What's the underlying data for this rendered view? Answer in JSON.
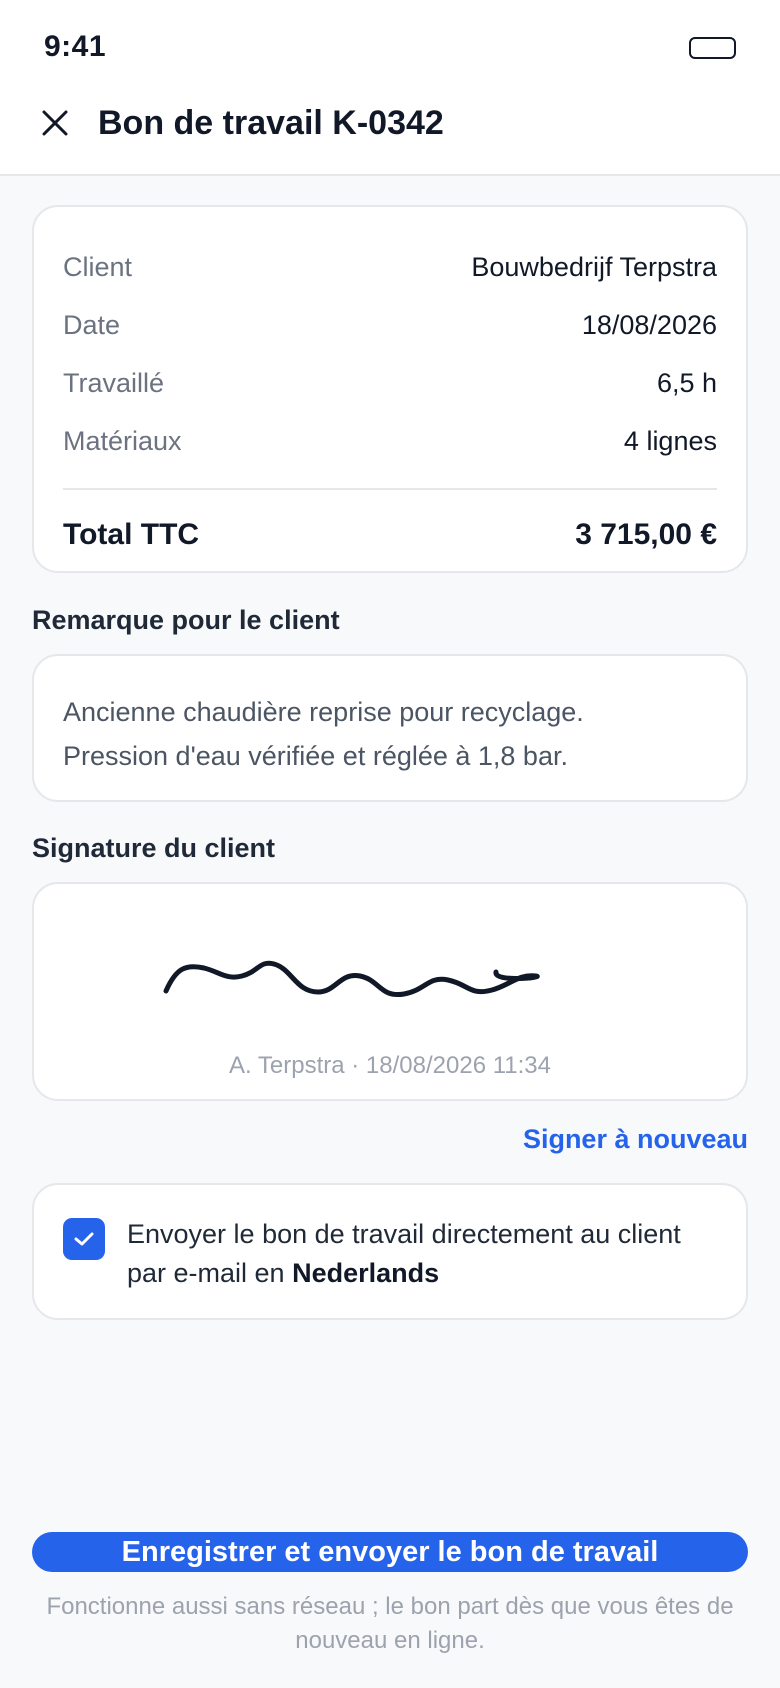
{
  "status_bar": {
    "time": "9:41"
  },
  "header": {
    "title": "Bon de travail K-0342"
  },
  "summary": {
    "rows": [
      {
        "label": "Client",
        "value": "Bouwbedrijf Terpstra"
      },
      {
        "label": "Date",
        "value": "18/08/2026"
      },
      {
        "label": "Travaillé",
        "value": "6,5 h"
      },
      {
        "label": "Matériaux",
        "value": "4 lignes"
      }
    ],
    "total_label": "Total TTC",
    "total_value": "3 715,00 €"
  },
  "remark": {
    "label": "Remarque pour le client",
    "lines": [
      "Ancienne chaudière reprise pour recyclage.",
      "Pression d'eau vérifiée et réglée à 1,8 bar."
    ]
  },
  "signature": {
    "label": "Signature du client",
    "caption": "A. Terpstra · 18/08/2026 11:34",
    "resign_label": "Signer à nouveau"
  },
  "email_option": {
    "checked": true,
    "text": "Envoyer le bon de travail directement au client par e-mail en",
    "language": "Nederlands"
  },
  "primary_action": {
    "label": "Enregistrer et envoyer le bon de travail"
  },
  "footnote": "Fonctionne aussi sans réseau ; le bon part dès que vous êtes de nouveau en ligne.",
  "colors": {
    "accent": "#2563eb",
    "text": "#111827",
    "muted": "#6b7280",
    "border": "#e5e7eb"
  },
  "icons": {
    "close": "close-icon",
    "check": "check-icon",
    "battery": "battery-icon"
  }
}
